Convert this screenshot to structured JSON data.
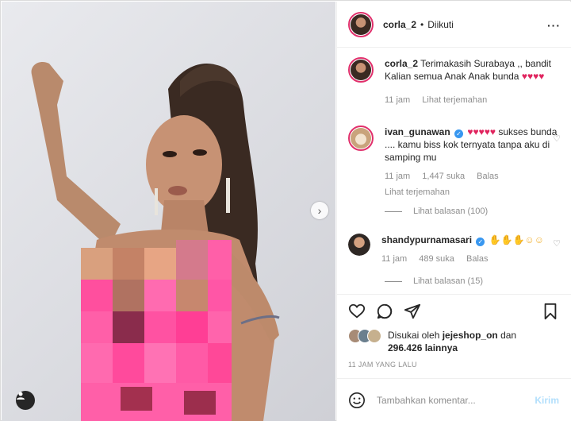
{
  "post": {
    "photo_alt": "Post image",
    "next_icon": "chevron-right-icon",
    "tag_icon": "user-tag-icon"
  },
  "header": {
    "username": "corla_2",
    "separator": "•",
    "follow_status": "Diikuti",
    "more_icon": "more-horizontal-icon",
    "more_label": "···"
  },
  "caption": {
    "username": "corla_2",
    "text": "Terimakasih Surabaya ,, bandit Kalian semua Anak Anak bunda",
    "hearts": "♥♥♥♥",
    "time": "11 jam",
    "translate": "Lihat terjemahan"
  },
  "comments": [
    {
      "username": "ivan_gunawan",
      "verified": true,
      "hearts": "♥♥♥♥♥",
      "text": "sukses bunda .... kamu biss kok ternyata tanpa aku di samping mu",
      "time": "11 jam",
      "likes": "1,447 suka",
      "reply": "Balas",
      "translate": "Lihat terjemahan",
      "view_replies": "Lihat balasan (100)"
    },
    {
      "username": "shandypurnamasari",
      "verified": true,
      "emojis": "✋✋✋☺☺",
      "text": "",
      "time": "11 jam",
      "likes": "489 suka",
      "reply": "Balas",
      "view_replies": "Lihat balasan (15)"
    }
  ],
  "actions": {
    "like_icon": "heart-icon",
    "comment_icon": "comment-icon",
    "share_icon": "send-icon",
    "save_icon": "bookmark-icon"
  },
  "likes": {
    "prefix": "Disukai oleh",
    "user": "jejeshop_on",
    "mid": "dan",
    "count": "296.426 lainnya"
  },
  "timestamp": "11 JAM YANG LALU",
  "add_comment": {
    "emoji_icon": "smiley-icon",
    "placeholder": "Tambahkan komentar...",
    "send": "Kirim"
  },
  "colors": {
    "accent": "#3897f0",
    "heart_red": "#e0245e",
    "dress_pink": "#ff5fa8"
  }
}
